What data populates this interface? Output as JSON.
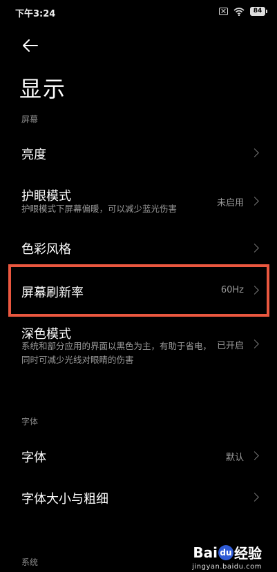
{
  "status_bar": {
    "time": "下午3:24",
    "battery": "84"
  },
  "page": {
    "title": "显示"
  },
  "sections": [
    {
      "header": "屏幕"
    },
    {
      "header": "字体"
    },
    {
      "header": "系统"
    }
  ],
  "items": {
    "brightness": {
      "label": "亮度"
    },
    "eye_care": {
      "label": "护眼模式",
      "sub": "护眼模式下屏幕偏暖，可以减少蓝光伤害",
      "value": "未启用"
    },
    "color_style": {
      "label": "色彩风格"
    },
    "refresh_rate": {
      "label": "屏幕刷新率",
      "value": "60Hz"
    },
    "dark_mode": {
      "label": "深色模式",
      "sub": "系统和部分应用的界面以黑色为主，有助于省电，同时可减少光线对眼睛的伤害",
      "value": "已开启"
    },
    "font": {
      "label": "字体",
      "value": "默认"
    },
    "font_size": {
      "label": "字体大小与粗细"
    }
  },
  "watermark": {
    "main_a": "Bai",
    "main_b": "du",
    "main_c": "经验",
    "sub": "jingyan.baidu.com"
  },
  "colors": {
    "background": "#000000",
    "highlight": "#e9573f",
    "secondary_text": "#9a9a9a"
  }
}
